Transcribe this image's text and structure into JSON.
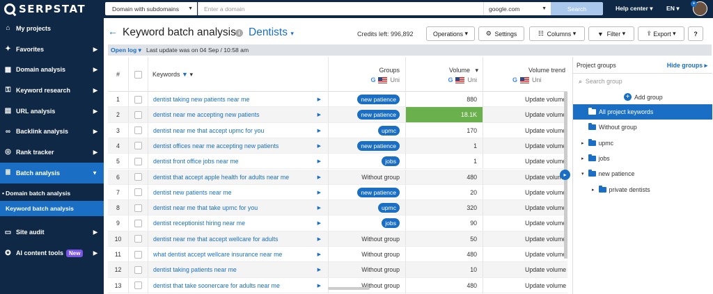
{
  "app": {
    "logo": "SERPSTAT"
  },
  "sidebar": {
    "items": [
      {
        "label": "My projects",
        "icon": "home-icon"
      },
      {
        "label": "Favorites",
        "icon": "pin-icon"
      },
      {
        "label": "Domain analysis",
        "icon": "chart-icon"
      },
      {
        "label": "Keyword research",
        "icon": "key-icon"
      },
      {
        "label": "URL analysis",
        "icon": "document-icon"
      },
      {
        "label": "Backlink analysis",
        "icon": "link-icon"
      },
      {
        "label": "Rank tracker",
        "icon": "target-icon"
      },
      {
        "label": "Batch analysis",
        "icon": "database-icon"
      }
    ],
    "sub_items": [
      "Domain batch analysis",
      "Keyword batch analysis"
    ],
    "items2": [
      {
        "label": "Site audit",
        "icon": "monitor-icon"
      },
      {
        "label": "AI content tools",
        "icon": "ai-icon",
        "badge": "New"
      }
    ]
  },
  "topbar": {
    "domain_select": "Domain with subdomains",
    "domain_placeholder": "Enter a domain",
    "search_engine": "google.com",
    "search_button": "Search",
    "help": "Help center",
    "lang": "EN"
  },
  "header": {
    "title": "Keyword batch analysis",
    "project": "Dentists",
    "credits": "Credits left: 996,892",
    "buttons": {
      "operations": "Operations",
      "settings": "Settings",
      "columns": "Columns",
      "filter": "Filter",
      "export": "Export"
    }
  },
  "infobar": {
    "open_log": "Open log",
    "last_update": "Last update was on 04 Sep / 10:58 am"
  },
  "table": {
    "headers": {
      "num": "#",
      "keywords": "Keywords",
      "groups": "Groups",
      "volume": "Volume",
      "trend": "Volume trend",
      "region": "Uni"
    },
    "rows": [
      {
        "n": "1",
        "kw": "dentist taking new patients near me",
        "group": "new patience",
        "pill": true,
        "vol": "880",
        "trend": "Update volume"
      },
      {
        "n": "2",
        "kw": "dentist near me accepting new patients",
        "group": "new patience",
        "pill": true,
        "vol": "18.1K",
        "trend": "Update volume",
        "hl": true
      },
      {
        "n": "3",
        "kw": "dentist near me that accept upmc for you",
        "group": "upmc",
        "pill": true,
        "vol": "170",
        "trend": "Update volume"
      },
      {
        "n": "4",
        "kw": "dentist offices near me accepting new patients",
        "group": "new patience",
        "pill": true,
        "vol": "1",
        "trend": "Update volume"
      },
      {
        "n": "5",
        "kw": "dentist front office jobs near me",
        "group": "jobs",
        "pill": true,
        "vol": "1",
        "trend": "Update volume"
      },
      {
        "n": "6",
        "kw": "dentist that accept apple health for adults near me",
        "group": "Without group",
        "pill": false,
        "vol": "480",
        "trend": "Update volume"
      },
      {
        "n": "7",
        "kw": "dentist new patients near me",
        "group": "new patience",
        "pill": true,
        "vol": "20",
        "trend": "Update volume"
      },
      {
        "n": "8",
        "kw": "dentist near me that take upmc for you",
        "group": "upmc",
        "pill": true,
        "vol": "320",
        "trend": "Update volume"
      },
      {
        "n": "9",
        "kw": "dentist receptionist hiring near me",
        "group": "jobs",
        "pill": true,
        "vol": "90",
        "trend": "Update volume"
      },
      {
        "n": "10",
        "kw": "dentist near me that accept wellcare for adults",
        "group": "Without group",
        "pill": false,
        "vol": "50",
        "trend": "Update volume"
      },
      {
        "n": "11",
        "kw": "what dentist accept wellcare insurance near me",
        "group": "Without group",
        "pill": false,
        "vol": "480",
        "trend": "Update volume"
      },
      {
        "n": "12",
        "kw": "dentist taking patients near me",
        "group": "Without group",
        "pill": false,
        "vol": "10",
        "trend": "Update volume"
      },
      {
        "n": "13",
        "kw": "dentist that take soonercare for adults near me",
        "group": "Without group",
        "pill": false,
        "vol": "480",
        "trend": "Update volume"
      }
    ]
  },
  "panel": {
    "title": "Project groups",
    "hide": "Hide groups",
    "search_placeholder": "Search group",
    "add": "Add group",
    "groups": [
      {
        "label": "All project keywords",
        "selected": true,
        "level": 0,
        "caret": ""
      },
      {
        "label": "Without group",
        "selected": false,
        "level": 0,
        "caret": ""
      },
      {
        "label": "upmc",
        "selected": false,
        "level": 0,
        "caret": "▸"
      },
      {
        "label": "jobs",
        "selected": false,
        "level": 0,
        "caret": "▸"
      },
      {
        "label": "new patience",
        "selected": false,
        "level": 0,
        "caret": "▾"
      },
      {
        "label": "private dentists",
        "selected": false,
        "level": 1,
        "caret": "▸"
      }
    ]
  },
  "colors": {
    "sidebar": "#0f2845",
    "accent": "#1a6fc4",
    "highlight": "#6ab04c"
  }
}
